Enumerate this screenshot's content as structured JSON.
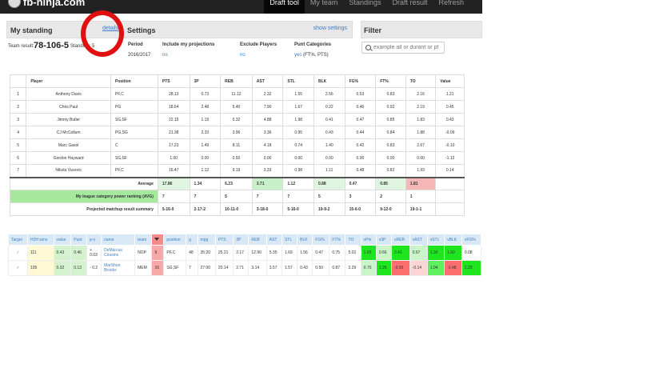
{
  "app": {
    "brand": "fb-ninja.com"
  },
  "nav": [
    "Draft tool",
    "My team",
    "Standings",
    "Draft result",
    "Refresh"
  ],
  "standing": {
    "title": "My standing",
    "details_link": "details",
    "team_result_label": "Team result:",
    "team_result_value": "78-106-5",
    "standing_label": "Standing: 5"
  },
  "settings": {
    "title": "Settings",
    "show_settings": "show settings",
    "period_label": "Period",
    "period_value": "2016/2017",
    "projections_label": "Include my projections",
    "projections_value": "no",
    "exclude_label": "Exclude Players",
    "exclude_value": "no",
    "punt_label": "Punt Categories",
    "punt_value": "yes",
    "punt_detail": "(FT%, PTS)"
  },
  "filter": {
    "title": "Filter",
    "placeholder": "example all or durant or pf"
  },
  "players_table": {
    "headers": [
      "",
      "Player",
      "Position",
      "PTS",
      "3P",
      "REB",
      "AST",
      "STL",
      "BLK",
      "FG%",
      "FT%",
      "TO",
      "Value"
    ],
    "rows": [
      [
        "1",
        "Anthony Davis",
        "PF,C",
        "28.13",
        "0.73",
        "11.12",
        "2.32",
        "1.55",
        "2.56",
        "0.53",
        "0.83",
        "2.16",
        "1.21"
      ],
      [
        "2",
        "Chris Paul",
        "PG",
        "18.64",
        "2.48",
        "5.40",
        "7.90",
        "1.67",
        "0.22",
        "0.46",
        "0.92",
        "2.19",
        "0.45"
      ],
      [
        "3",
        "Jimmy Butler",
        "SG,SF",
        "22.15",
        "1.19",
        "5.32",
        "4.88",
        "1.98",
        "0.41",
        "0.47",
        "0.85",
        "1.83",
        "0.43"
      ],
      [
        "4",
        "CJ McCollum",
        "PG,SG",
        "21.38",
        "2.33",
        "3.96",
        "3.36",
        "0.95",
        "0.43",
        "0.44",
        "0.84",
        "1.88",
        "-0.09"
      ],
      [
        "5",
        "Marc Gasol",
        "C",
        "17.23",
        "1.49",
        "8.11",
        "4.18",
        "0.74",
        "1.40",
        "0.42",
        "0.83",
        "2.67",
        "-0.10"
      ],
      [
        "6",
        "Gordon Hayward",
        "SG,SF",
        "1.00",
        "0.00",
        "0.50",
        "0.00",
        "0.00",
        "0.00",
        "0.00",
        "0.00",
        "0.00",
        "-1.12"
      ],
      [
        "7",
        "Nikola Vucevic",
        "PF,C",
        "16.47",
        "1.12",
        "9.19",
        "3.33",
        "0.98",
        "1.11",
        "0.48",
        "0.82",
        "1.93",
        "0.14"
      ]
    ],
    "average_label": "Average",
    "average": [
      "17.86",
      "1.34",
      "6.23",
      "3.71",
      "1.12",
      "0.88",
      "0.47",
      "0.85",
      "1.81"
    ],
    "power_label": "My league category power ranking (AVG)",
    "power": [
      "7",
      "7",
      "5",
      "7",
      "7",
      "5",
      "3",
      "2",
      "1"
    ],
    "matchup_label": "Projected matchup result summary",
    "matchup": [
      "5-16-0",
      "2-17-2",
      "10-11-0",
      "3-18-0",
      "5-16-0",
      "10-9-2",
      "15-6-0",
      "9-12-0",
      "19-1-1"
    ]
  },
  "draft_table": {
    "headers": [
      "Target",
      "H2H wins",
      "value",
      "Punt",
      "p-v",
      "name",
      "team",
      "",
      "position",
      "g",
      "mpg",
      "PTS",
      "3P",
      "REB",
      "AST",
      "STL",
      "BLK",
      "FG%",
      "FT%",
      "TO",
      "vPts",
      "v3P",
      "vREB",
      "vAST",
      "vSTL",
      "vBLK",
      "vFG%"
    ],
    "rows": [
      {
        "check": "✓",
        "h2h": "111",
        "value": "0.43",
        "punt": "0.46",
        "pv": "+ 0.03",
        "name": "DeMarcus Cousins",
        "team": "NOP",
        "rank": "9",
        "position": "PF,C",
        "g": "48",
        "mpg": "35:20",
        "pts": "25.21",
        "tp": "2.17",
        "reb": "12.90",
        "ast": "5.35",
        "stl": "1.69",
        "blk": "1.56",
        "fg": "0.47",
        "ft": "0.75",
        "to": "5.02",
        "vpts": "1.65",
        "v3p": "0.66",
        "vreb": "2.41",
        "vast": "0.67",
        "vstl": "1.30",
        "vblk": "1.60",
        "vfg": "0.08"
      },
      {
        "check": "✓",
        "h2h": "105",
        "value": "0.32",
        "punt": "0.13",
        "pv": "- 0.2",
        "name": "MarShon Brooks",
        "team": "MEM",
        "rank": "16",
        "position": "SG,SF",
        "g": "7",
        "mpg": "27:00",
        "pts": "20.14",
        "tp": "2.71",
        "reb": "3.14",
        "ast": "3.57",
        "stl": "1.57",
        "blk": "0.43",
        "fg": "0.50",
        "ft": "0.87",
        "to": "2.29",
        "vpts": "0.70",
        "v3p": "1.26",
        "vreb": "-0.99",
        "vast": "-0.14",
        "vstl": "1.04",
        "vblk": "-0.48",
        "vfg": "1.20"
      }
    ]
  }
}
